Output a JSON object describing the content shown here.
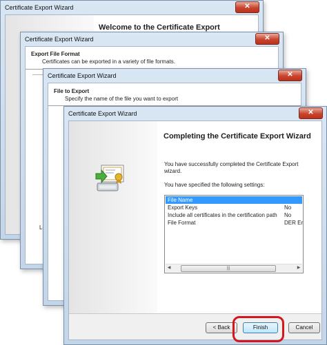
{
  "windows": [
    {
      "title": "Certificate Export Wizard",
      "header_title": "Welcome to the Certificate Export",
      "close_glyph": "✕"
    },
    {
      "title": "Certificate Export Wizard",
      "header_title": "Export File Format",
      "header_subtitle": "Certificates can be exported in a variety of file formats.",
      "footer_text": "Lea",
      "close_glyph": "✕"
    },
    {
      "title": "Certificate Export Wizard",
      "header_title": "File to Export",
      "header_subtitle": "Specify the name of the file you want to export",
      "close_glyph": "✕"
    }
  ],
  "main_window": {
    "title": "Certificate Export Wizard",
    "close_glyph": "✕",
    "heading": "Completing the Certificate Export Wizard",
    "description": "You have successfully completed the Certificate Export wizard.",
    "settings_label": "You have specified the following settings:",
    "settings": [
      {
        "name": "File Name",
        "value": "",
        "selected": true
      },
      {
        "name": "Export Keys",
        "value": "No",
        "selected": false
      },
      {
        "name": "Include all certificates in the certification path",
        "value": "No",
        "selected": false
      },
      {
        "name": "File Format",
        "value": "DER Enc",
        "selected": false
      }
    ],
    "scrollbar": {
      "left_arrow": "◀",
      "right_arrow": "▶",
      "grip": "|||"
    },
    "buttons": {
      "back": "< Back",
      "finish": "Finish",
      "cancel": "Cancel"
    },
    "icon": "certificate-export-icon",
    "highlight_color": "#d6151c",
    "selection_color": "#3399ff"
  }
}
